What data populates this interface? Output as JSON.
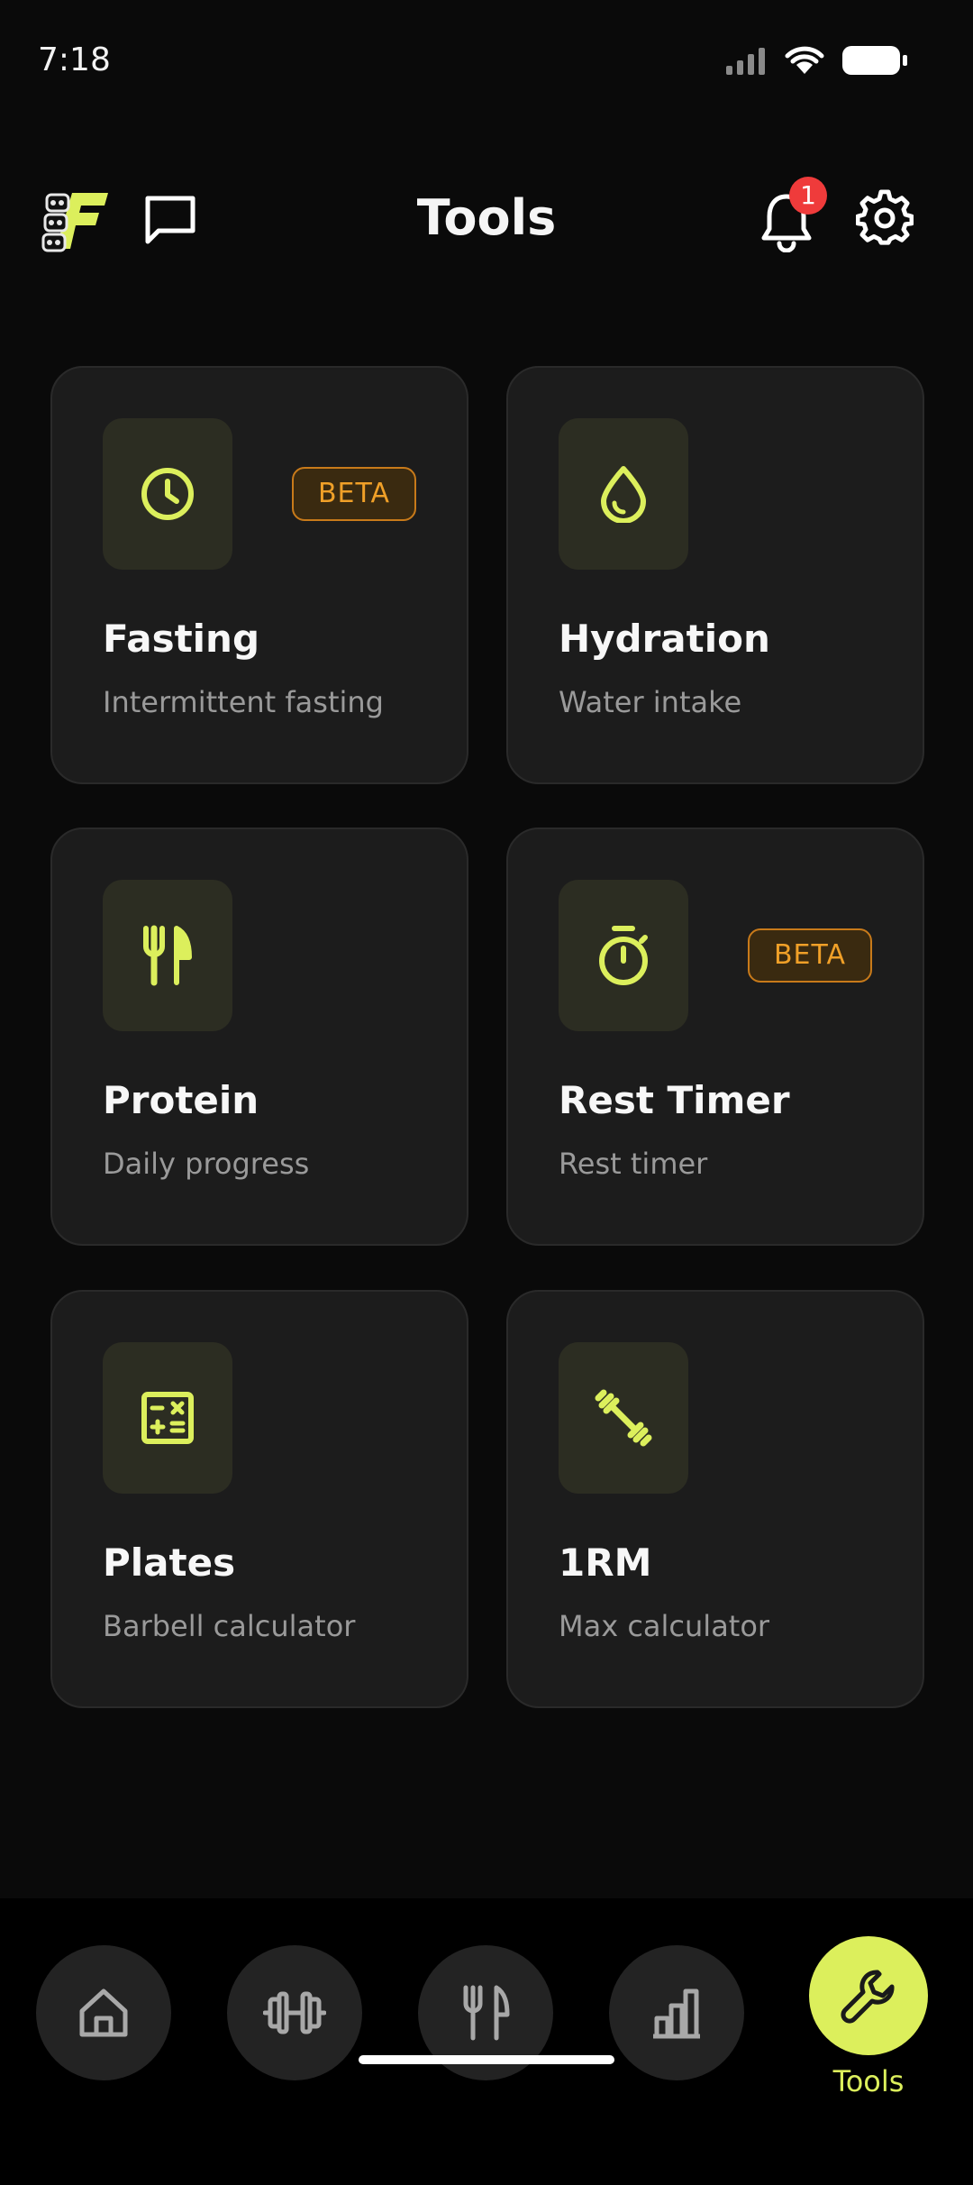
{
  "status_bar": {
    "time": "7:18"
  },
  "header": {
    "title": "Tools",
    "notification_count": "1"
  },
  "tools": [
    {
      "title": "Fasting",
      "subtitle": "Intermittent fasting",
      "badge": "BETA",
      "icon": "clock-icon"
    },
    {
      "title": "Hydration",
      "subtitle": "Water intake",
      "badge": "",
      "icon": "water-drop-icon"
    },
    {
      "title": "Protein",
      "subtitle": "Daily progress",
      "badge": "",
      "icon": "fork-knife-icon"
    },
    {
      "title": "Rest Timer",
      "subtitle": "Rest timer",
      "badge": "BETA",
      "icon": "stopwatch-icon"
    },
    {
      "title": "Plates",
      "subtitle": "Barbell calculator",
      "badge": "",
      "icon": "calculator-icon"
    },
    {
      "title": "1RM",
      "subtitle": "Max calculator",
      "badge": "",
      "icon": "dumbbell-icon"
    }
  ],
  "bottom_nav": {
    "items": [
      {
        "icon": "home-icon"
      },
      {
        "icon": "dumbbell-icon"
      },
      {
        "icon": "fork-knife-icon"
      },
      {
        "icon": "bar-chart-icon"
      },
      {
        "icon": "wrench-icon",
        "label": "Tools",
        "active": true
      }
    ]
  },
  "colors": {
    "accent": "#dcef5c",
    "badge": "#f0a028",
    "background": "#0a0a0a",
    "card": "#1c1c1c",
    "notification": "#ef3b3b"
  }
}
